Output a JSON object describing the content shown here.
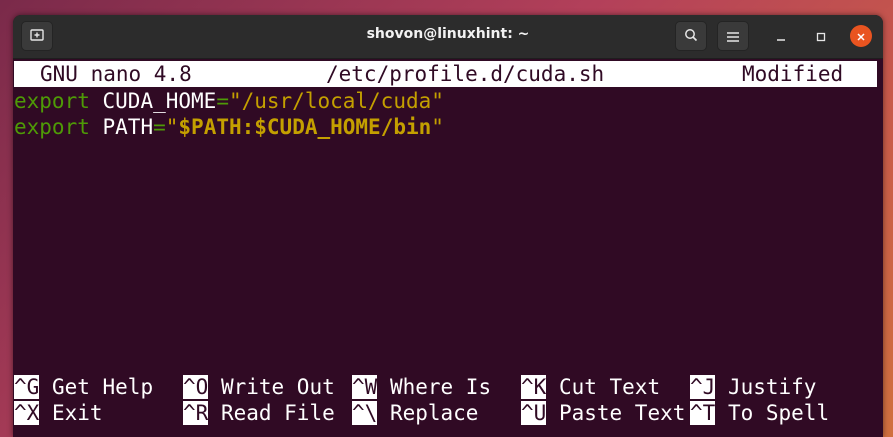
{
  "window": {
    "title": "shovon@linuxhint: ~"
  },
  "icons": {
    "new_tab": "new-tab-icon",
    "search": "search-icon",
    "menu": "hamburger-menu-icon",
    "minimize": "minimize-icon",
    "maximize": "maximize-icon",
    "close": "close-icon"
  },
  "colors": {
    "terminal_bg": "#300a24",
    "keyword": "#4e9a06",
    "string": "#c4a000",
    "close_button": "#e95420"
  },
  "nano": {
    "version": "GNU nano 4.8",
    "filename": "/etc/profile.d/cuda.sh",
    "status": "Modified"
  },
  "code": [
    {
      "keyword": "export",
      "name": "CUDA_HOME",
      "eq": "=",
      "value_prefix": "\"/usr/local/cuda\"",
      "value_var": "",
      "value_suffix": ""
    },
    {
      "keyword": "export",
      "name": "PATH",
      "eq": "=",
      "value_prefix": "\"",
      "value_var": "$PATH:$CUDA_HOME/bin",
      "value_suffix": "\""
    }
  ],
  "shortcuts": {
    "row1": [
      {
        "key": "^G",
        "label": "Get Help"
      },
      {
        "key": "^O",
        "label": "Write Out"
      },
      {
        "key": "^W",
        "label": "Where Is"
      },
      {
        "key": "^K",
        "label": "Cut Text"
      },
      {
        "key": "^J",
        "label": "Justify"
      }
    ],
    "row2": [
      {
        "key": "^X",
        "label": "Exit"
      },
      {
        "key": "^R",
        "label": "Read File"
      },
      {
        "key": "^\\",
        "label": "Replace"
      },
      {
        "key": "^U",
        "label": "Paste Text"
      },
      {
        "key": "^T",
        "label": "To Spell"
      }
    ]
  }
}
